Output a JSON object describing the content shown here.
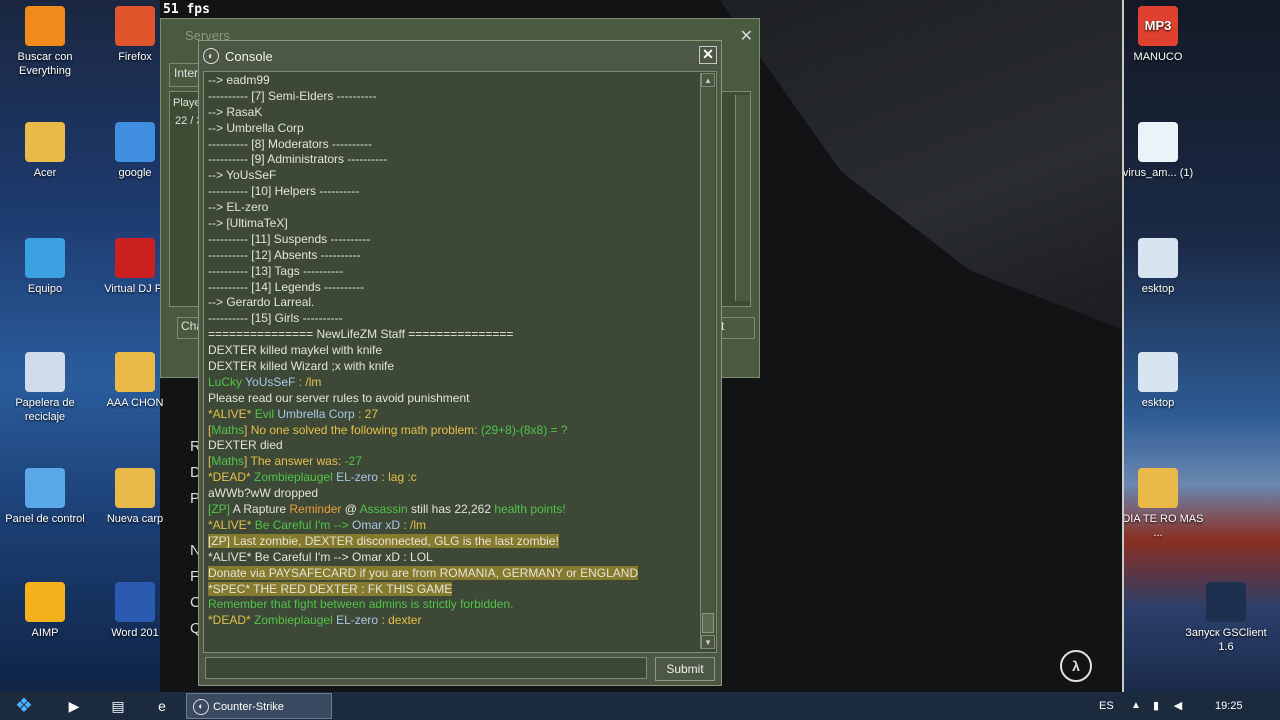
{
  "fps": "51 fps",
  "desktop_left": [
    {
      "label": "Buscar con Everything",
      "icon": "search-icon",
      "color": "#f08a1c"
    },
    {
      "label": "Firefox",
      "icon": "firefox-icon",
      "color": "#e0552b"
    },
    {
      "label": "Acer",
      "icon": "folder-user-icon",
      "color": "#e9b94a"
    },
    {
      "label": "google",
      "icon": "chrome-icon",
      "color": "#3f8ee0"
    },
    {
      "label": "Equipo",
      "icon": "computer-icon",
      "color": "#3aa0e0"
    },
    {
      "label": "Virtual DJ Pr",
      "icon": "vinyl-icon",
      "color": "#cc1f1f"
    },
    {
      "label": "Papelera de reciclaje",
      "icon": "recycle-bin-icon",
      "color": "#d0dceb"
    },
    {
      "label": "AAA CHON",
      "icon": "folder-icon",
      "color": "#e9b94a"
    },
    {
      "label": "Panel de control",
      "icon": "control-panel-icon",
      "color": "#5aa8e8"
    },
    {
      "label": "Nueva carp",
      "icon": "folder-icon",
      "color": "#e9b94a"
    },
    {
      "label": "AIMP",
      "icon": "aimp-icon",
      "color": "#f3b21c"
    },
    {
      "label": "Word 201",
      "icon": "word-icon",
      "color": "#2b5bb0"
    }
  ],
  "desktop_right": [
    {
      "label": "MANUCO",
      "top_label": "MP3",
      "icon": "mp3-icon",
      "color": "#e04030"
    },
    {
      "label": "virus_am... (1)",
      "icon": "document-icon",
      "color": "#eaf4f8"
    },
    {
      "label": "esktop",
      "icon": "file-icon",
      "color": "#d8e4f0"
    },
    {
      "label": "esktop",
      "icon": "file-icon",
      "color": "#d8e4f0"
    },
    {
      "label": "A DIA TE RO MAS ...",
      "icon": "folder-icon",
      "color": "#e9b94a"
    },
    {
      "label": "Запуск GSClient 1.6",
      "icon": "gsclient-icon",
      "color": "#1e3050"
    }
  ],
  "side_letters": [
    "R",
    "D",
    "P",
    "N",
    "F",
    "C",
    "Q"
  ],
  "servers": {
    "title": "Servers",
    "tab": "Inter",
    "column": "Playe",
    "count": "22 / 3",
    "chat_btn": "Cha",
    "right_btn": "t"
  },
  "console": {
    "title": "Console",
    "close": "✕",
    "submit": "Submit",
    "lines": [
      {
        "parts": [
          {
            "t": "--> eadm99",
            "c": "white"
          }
        ]
      },
      {
        "parts": [
          {
            "t": "---------- [7] Semi-Elders ----------",
            "c": "white"
          }
        ]
      },
      {
        "parts": [
          {
            "t": "--> RasaK",
            "c": "white"
          }
        ]
      },
      {
        "parts": [
          {
            "t": "--> Umbrella Corp",
            "c": "white"
          }
        ]
      },
      {
        "parts": [
          {
            "t": "---------- [8] Moderators ----------",
            "c": "white"
          }
        ]
      },
      {
        "parts": [
          {
            "t": "---------- [9] Administrators ----------",
            "c": "white"
          }
        ]
      },
      {
        "parts": [
          {
            "t": "--> YoUsSeF",
            "c": "white"
          }
        ]
      },
      {
        "parts": [
          {
            "t": "---------- [10] Helpers ----------",
            "c": "white"
          }
        ]
      },
      {
        "parts": [
          {
            "t": "--> EL-zero",
            "c": "white"
          }
        ]
      },
      {
        "parts": [
          {
            "t": "--> [UltimaTeX]",
            "c": "white"
          }
        ]
      },
      {
        "parts": [
          {
            "t": "---------- [11] Suspends ----------",
            "c": "white"
          }
        ]
      },
      {
        "parts": [
          {
            "t": "---------- [12] Absents ----------",
            "c": "white"
          }
        ]
      },
      {
        "parts": [
          {
            "t": "---------- [13] Tags ----------",
            "c": "white"
          }
        ]
      },
      {
        "parts": [
          {
            "t": "---------- [14] Legends ----------",
            "c": "white"
          }
        ]
      },
      {
        "parts": [
          {
            "t": "--> Gerardo Larreal.",
            "c": "white"
          }
        ]
      },
      {
        "parts": [
          {
            "t": "---------- [15] Girls ----------",
            "c": "white"
          }
        ]
      },
      {
        "parts": [
          {
            "t": "=============== NewLifeZM Staff ===============",
            "c": "white"
          }
        ]
      },
      {
        "parts": [
          {
            "t": "DEXTER killed maykel with knife",
            "c": "white"
          }
        ]
      },
      {
        "parts": [
          {
            "t": "DEXTER killed Wizard ;x with knife",
            "c": "white"
          }
        ]
      },
      {
        "parts": [
          {
            "t": "LuCky ",
            "c": "green"
          },
          {
            "t": "YoUsSeF",
            "c": "blue"
          },
          {
            "t": " :  /lm",
            "c": "yellow"
          }
        ]
      },
      {
        "parts": [
          {
            "t": "Please read our server rules to avoid punishment",
            "c": "white"
          }
        ]
      },
      {
        "parts": [
          {
            "t": "*ALIVE* ",
            "c": "yellow"
          },
          {
            "t": "Evil ",
            "c": "green"
          },
          {
            "t": "Umbrella Corp",
            "c": "blue"
          },
          {
            "t": " :  27",
            "c": "yellow"
          }
        ]
      },
      {
        "parts": [
          {
            "t": "[",
            "c": "yellow"
          },
          {
            "t": "Maths",
            "c": "green"
          },
          {
            "t": "] No one solved the following math problem: ",
            "c": "yellow"
          },
          {
            "t": "(29+8)-(8x8) = ?",
            "c": "green"
          }
        ]
      },
      {
        "parts": [
          {
            "t": "DEXTER died",
            "c": "white"
          }
        ]
      },
      {
        "parts": [
          {
            "t": "[",
            "c": "yellow"
          },
          {
            "t": "Maths",
            "c": "green"
          },
          {
            "t": "] The answer was: ",
            "c": "yellow"
          },
          {
            "t": "-27",
            "c": "green"
          }
        ]
      },
      {
        "parts": [
          {
            "t": "*DEAD* ",
            "c": "yellow"
          },
          {
            "t": "Zombieplaugel ",
            "c": "green"
          },
          {
            "t": "EL-zero",
            "c": "blue"
          },
          {
            "t": " :  lag :c",
            "c": "yellow"
          }
        ]
      },
      {
        "parts": [
          {
            "t": "aWWb?wW dropped",
            "c": "white"
          }
        ]
      },
      {
        "parts": [
          {
            "t": "[ZP] ",
            "c": "green"
          },
          {
            "t": "A Rapture ",
            "c": "white"
          },
          {
            "t": "Reminder",
            "c": "orange"
          },
          {
            "t": " @ ",
            "c": "white"
          },
          {
            "t": "Assassin",
            "c": "green"
          },
          {
            "t": " still has 22,262 ",
            "c": "white"
          },
          {
            "t": "health points!",
            "c": "green"
          }
        ]
      },
      {
        "parts": [
          {
            "t": "*ALIVE* ",
            "c": "yellow"
          },
          {
            "t": "Be Careful I'm --> ",
            "c": "green"
          },
          {
            "t": "Omar xD",
            "c": "blue"
          },
          {
            "t": " :  /lm",
            "c": "yellow"
          }
        ]
      },
      {
        "hl": true,
        "parts": [
          {
            "t": "[ZP] Last zombie, DEXTER disconnected, GLG is the last zombie!",
            "c": "white"
          }
        ]
      },
      {
        "parts": [
          {
            "t": "*ALIVE* Be Careful I'm --> Omar xD :  LOL",
            "c": "white"
          }
        ]
      },
      {
        "hl": true,
        "parts": [
          {
            "t": "Donate via PAYSAFECARD if you are from ROMANIA, GERMANY or ENGLAND",
            "c": "white"
          }
        ]
      },
      {
        "hl": true,
        "parts": [
          {
            "t": "*SPEC* THE RED DEXTER :  FK THIS GAME",
            "c": "white"
          }
        ]
      },
      {
        "parts": [
          {
            "t": " Remember that fight between admins is strictly forbidden.",
            "c": "green"
          }
        ]
      },
      {
        "parts": [
          {
            "t": "*DEAD* ",
            "c": "yellow"
          },
          {
            "t": "Zombieplaugel ",
            "c": "green"
          },
          {
            "t": "EL-zero",
            "c": "blue"
          },
          {
            "t": " :  dexter",
            "c": "yellow"
          }
        ]
      }
    ]
  },
  "taskbar": {
    "task_label": "Counter-Strike",
    "lang": "ES",
    "time": "19:25"
  }
}
